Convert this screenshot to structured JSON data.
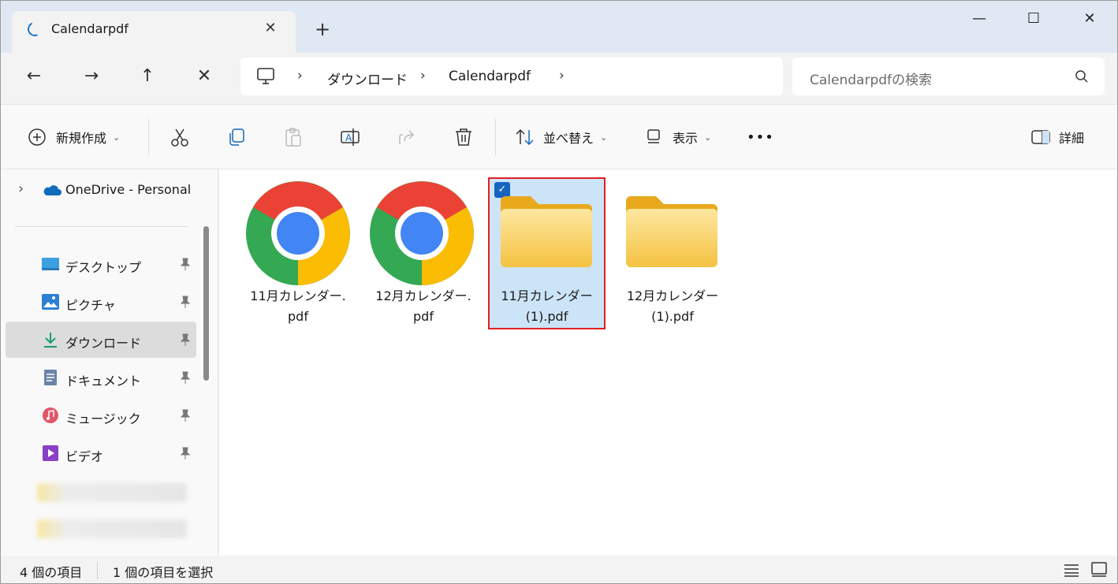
{
  "window": {
    "tab_title": "Calendarpdf",
    "tab_close": "✕",
    "new_tab": "+",
    "minimize": "—",
    "maximize": "☐",
    "close": "✕"
  },
  "nav": {
    "back": "←",
    "forward": "→",
    "up": "↑",
    "stop": "✕"
  },
  "address": {
    "chevron": "›",
    "segments": [
      "ダウンロード",
      "Calendarpdf"
    ]
  },
  "search": {
    "placeholder": "Calendarpdfの検索"
  },
  "toolbar": {
    "new_label": "新規作成",
    "sort_label": "並べ替え",
    "view_label": "表示",
    "more_label": "•••",
    "details_label": "詳細",
    "dropdown_caret": "⌄"
  },
  "sidebar": {
    "onedrive_label": "OneDrive - Personal",
    "expand_chevron": "›",
    "items": [
      {
        "label": "デスクトップ",
        "icon": "desktop-icon"
      },
      {
        "label": "ピクチャ",
        "icon": "pictures-icon"
      },
      {
        "label": "ダウンロード",
        "icon": "download-icon",
        "active": true
      },
      {
        "label": "ドキュメント",
        "icon": "documents-icon"
      },
      {
        "label": "ミュージック",
        "icon": "music-icon"
      },
      {
        "label": "ビデオ",
        "icon": "video-icon"
      }
    ]
  },
  "files": [
    {
      "line1": "11月カレンダー.",
      "line2": "pdf",
      "icon": "chrome-icon",
      "selected": false
    },
    {
      "line1": "12月カレンダー.",
      "line2": "pdf",
      "icon": "chrome-icon",
      "selected": false
    },
    {
      "line1": "11月カレンダー",
      "line2": "(1).pdf",
      "icon": "folder-icon",
      "selected": true
    },
    {
      "line1": "12月カレンダー",
      "line2": "(1).pdf",
      "icon": "folder-icon",
      "selected": false
    }
  ],
  "checkmark": "✓",
  "status": {
    "item_count": "4 個の項目",
    "selected_count": "1 個の項目を選択"
  },
  "colors": {
    "accent": "#1565c0",
    "selection": "#cce4f7",
    "highlight_border": "#e02020",
    "folder": "#f5c242"
  }
}
